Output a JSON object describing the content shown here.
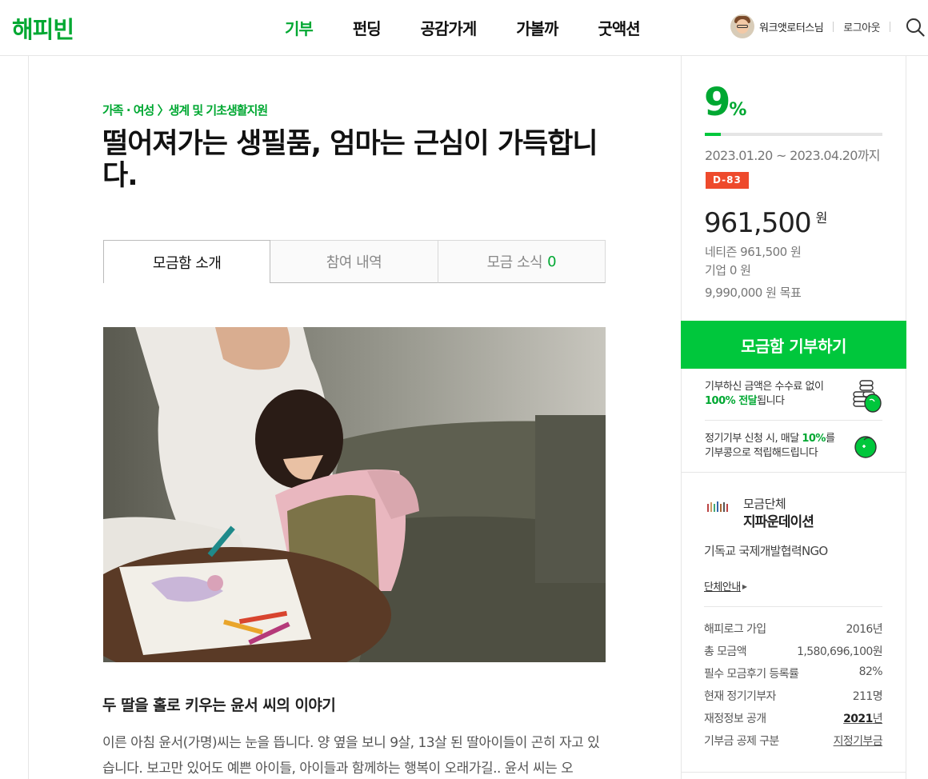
{
  "header": {
    "logo": "해피빈",
    "nav": [
      "기부",
      "펀딩",
      "공감가게",
      "가볼까",
      "굿액션"
    ],
    "active_nav": "기부",
    "user_name": "워크앳로터스님",
    "logout": "로그아웃"
  },
  "breadcrumb": "가족 · 여성 〉생계 및 기초생활지원",
  "title": "떨어져가는 생필품, 엄마는 근심이 가득합니다.",
  "tabs": [
    {
      "label": "모금함 소개",
      "count": ""
    },
    {
      "label": "참여 내역",
      "count": ""
    },
    {
      "label": "모금 소식",
      "count": "0"
    }
  ],
  "story": {
    "title": "두 딸을 홀로 키우는 윤서 씨의 이야기",
    "body": "이른 아침 윤서(가명)씨는 눈을 뜹니다. 양 옆을 보니 9살, 13살 된 딸아이들이 곤히 자고 있습니다. 보고만 있어도 예쁜 아이들, 아이들과 함께하는 행복이 오래가길.. 윤서 씨는 오"
  },
  "sidebar": {
    "percent": "9",
    "percent_unit": "%",
    "progress": 0.09,
    "period": "2023.01.20 ~ 2023.04.20",
    "period_suffix": "까지",
    "dday": "D-83",
    "amount": "961,500",
    "amount_unit": "원",
    "netizen": "네티즌 961,500 원",
    "company": "기업 0 원",
    "goal": "9,990,000 원 목표",
    "donate_button": "모금함 기부하기",
    "info1_line1": "기부하신 금액은 수수료 없이",
    "info1_highlight": "100% 전달",
    "info1_tail": "됩니다",
    "info2_prefix": "정기기부 신청 시, 매달 ",
    "info2_highlight": "10%",
    "info2_suffix": "를",
    "info2_line2": "기부콩으로 적립해드립니다",
    "org_label": "모금단체",
    "org_name": "지파운데이션",
    "org_desc": "기독교 국제개발협력NGO",
    "org_link": "단체안내",
    "stats": [
      {
        "label": "해피로그 가입",
        "value": "2016년"
      },
      {
        "label": "총 모금액",
        "value": "1,580,696,100원"
      },
      {
        "label": "필수 모금후기 등록률",
        "value": "82%"
      },
      {
        "label": "현재 정기기부자",
        "value": "211명"
      },
      {
        "label": "재정정보 공개",
        "value_bold": "2021",
        "value_tail": "년"
      },
      {
        "label": "기부금 공제 구분",
        "value": "지정기부금"
      }
    ]
  },
  "colors": {
    "brand_green": "#00a832",
    "button_green": "#00c73c",
    "dday_red": "#ee4a2c"
  },
  "icons": [
    "search-icon",
    "coins-icon",
    "bean-icon",
    "chevron-right-icon"
  ]
}
